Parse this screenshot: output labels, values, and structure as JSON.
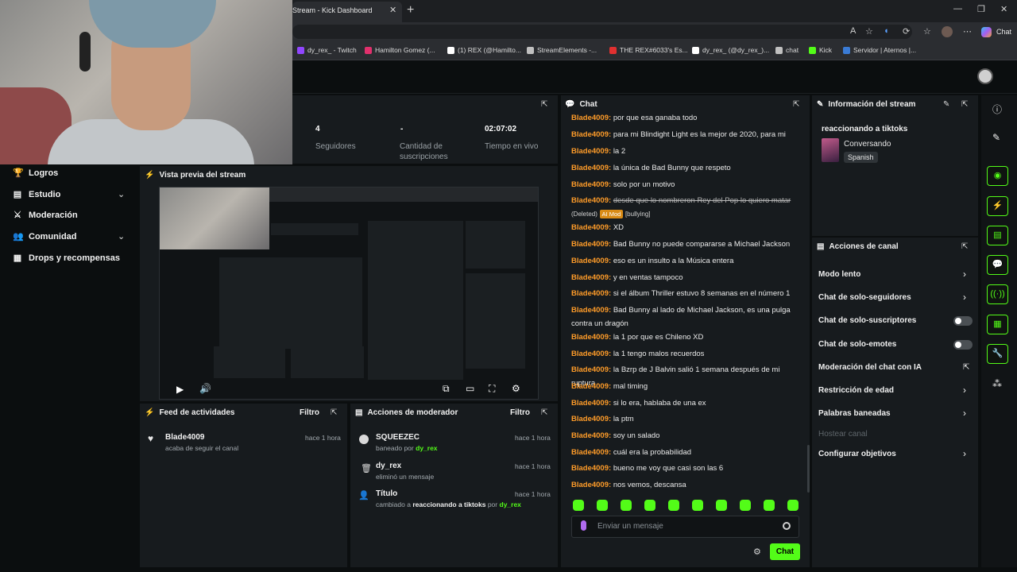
{
  "browser": {
    "tab_title": "Stream - Kick Dashboard",
    "copilot_label": "Chat",
    "bookmarks": [
      {
        "label": "dy_rex_ - Twitch",
        "color": "#9146ff"
      },
      {
        "label": "Hamilton Gomez (...",
        "color": "#e1306c"
      },
      {
        "label": "(1) REX (@Hamilto...",
        "color": "#ffffff"
      },
      {
        "label": "StreamElements -...",
        "color": "#c0c0c0"
      },
      {
        "label": "THE REX#6033's Es...",
        "color": "#e03030"
      },
      {
        "label": "dy_rex_ (@dy_rex_)...",
        "color": "#ffffff"
      },
      {
        "label": "chat",
        "color": "#c0c0c0"
      },
      {
        "label": "Kick",
        "color": "#53fc18"
      },
      {
        "label": "Servidor | Aternos |...",
        "color": "#3a7bd5"
      }
    ]
  },
  "sidebar": {
    "items": [
      {
        "label": "Logros",
        "icon": "trophy-icon"
      },
      {
        "label": "Estudio",
        "icon": "film-icon",
        "expandable": true
      },
      {
        "label": "Moderación",
        "icon": "sword-icon"
      },
      {
        "label": "Comunidad",
        "icon": "people-icon",
        "expandable": true
      },
      {
        "label": "Drops y recompensas",
        "icon": "drops-icon"
      }
    ]
  },
  "stats": {
    "followers_value": "4",
    "followers_label": "Seguidores",
    "subs_value": "-",
    "subs_label": "Cantidad de suscripciones",
    "uptime_value": "02:07:02",
    "uptime_label": "Tiempo en vivo"
  },
  "preview": {
    "title": "Vista previa del stream"
  },
  "activity": {
    "title": "Feed de actividades",
    "filter": "Filtro",
    "items": [
      {
        "name": "Blade4009",
        "text": "acaba de seguir el canal",
        "time": "hace 1 hora"
      }
    ]
  },
  "mod_actions": {
    "title": "Acciones de moderador",
    "filter": "Filtro",
    "items": [
      {
        "name": "SQUEEZEC",
        "pre": "baneado por",
        "who": "dy_rex",
        "time": "hace 1 hora"
      },
      {
        "name": "dy_rex",
        "pre": "eliminó un mensaje",
        "who": "",
        "time": "hace 1 hora"
      },
      {
        "name": "Título",
        "pre": "cambiado a",
        "bold": "reaccionando a tiktoks",
        "mid": "por",
        "who": "dy_rex",
        "time": "hace 1 hora"
      }
    ]
  },
  "chat": {
    "title": "Chat",
    "messages": [
      {
        "user": "Blade4009:",
        "text": "por que esa ganaba todo"
      },
      {
        "user": "Blade4009:",
        "text": "para mi Blindight Light es la mejor de 2020, para mi"
      },
      {
        "user": "Blade4009:",
        "text": "la 2"
      },
      {
        "user": "Blade4009:",
        "text": "la única de Bad Bunny que respeto"
      },
      {
        "user": "Blade4009:",
        "text": "solo por un motivo"
      },
      {
        "user": "Blade4009:",
        "text": "desde que lo nombreron Rey del Pop lo quiero matar",
        "deleted": "(Deleted)",
        "badge": "AI Mod",
        "reason": "[bullying]"
      },
      {
        "user": "Blade4009:",
        "text": "XD"
      },
      {
        "user": "Blade4009:",
        "text": "Bad Bunny no puede compararse a Michael Jackson"
      },
      {
        "user": "Blade4009:",
        "text": "eso es un insulto a la Música entera"
      },
      {
        "user": "Blade4009:",
        "text": "y en ventas tampoco"
      },
      {
        "user": "Blade4009:",
        "text": "si el álbum Thriller estuvo 8 semanas en el número 1"
      },
      {
        "user": "Blade4009:",
        "text": "Bad Bunny al lado de Michael Jackson, es una pulga contra un dragón"
      },
      {
        "user": "Blade4009:",
        "text": "la 1 por que es Chileno XD"
      },
      {
        "user": "Blade4009:",
        "text": "la 1 tengo malos recuerdos"
      },
      {
        "user": "Blade4009:",
        "text": "la Bzrp de J Balvin salió 1 semana después de mi ruptura"
      },
      {
        "user": "Blade4009:",
        "text": "mal timing"
      },
      {
        "user": "Blade4009:",
        "text": "si lo era, hablaba de una ex"
      },
      {
        "user": "Blade4009:",
        "text": "la ptm"
      },
      {
        "user": "Blade4009:",
        "text": "soy un salado"
      },
      {
        "user": "Blade4009:",
        "text": "cuál era la probabilidad"
      },
      {
        "user": "Blade4009:",
        "text": "bueno me voy que casi son las 6"
      },
      {
        "user": "Blade4009:",
        "text": "nos vemos, descansa"
      }
    ],
    "input_placeholder": "Enviar un mensaje",
    "send_label": "Chat"
  },
  "stream_info": {
    "title": "Información del stream",
    "stream_title": "reaccionando a tiktoks",
    "category": "Conversando",
    "language": "Spanish"
  },
  "channel_actions": {
    "title": "Acciones de canal",
    "items": [
      {
        "label": "Modo lento",
        "kind": "chevron"
      },
      {
        "label": "Chat de solo-seguidores",
        "kind": "chevron"
      },
      {
        "label": "Chat de solo-suscriptores",
        "kind": "toggle"
      },
      {
        "label": "Chat de solo-emotes",
        "kind": "toggle"
      },
      {
        "label": "Moderación del chat con IA",
        "kind": "external"
      },
      {
        "label": "Restricción de edad",
        "kind": "chevron"
      },
      {
        "label": "Palabras baneadas",
        "kind": "chevron"
      },
      {
        "label": "Hostear canal",
        "kind": "disabled"
      },
      {
        "label": "Configurar objetivos",
        "kind": "chevron"
      }
    ]
  },
  "colors": {
    "accent": "#53fc18",
    "username": "#ff9c29",
    "panel": "#171b1e",
    "background": "#0b0e0f"
  }
}
